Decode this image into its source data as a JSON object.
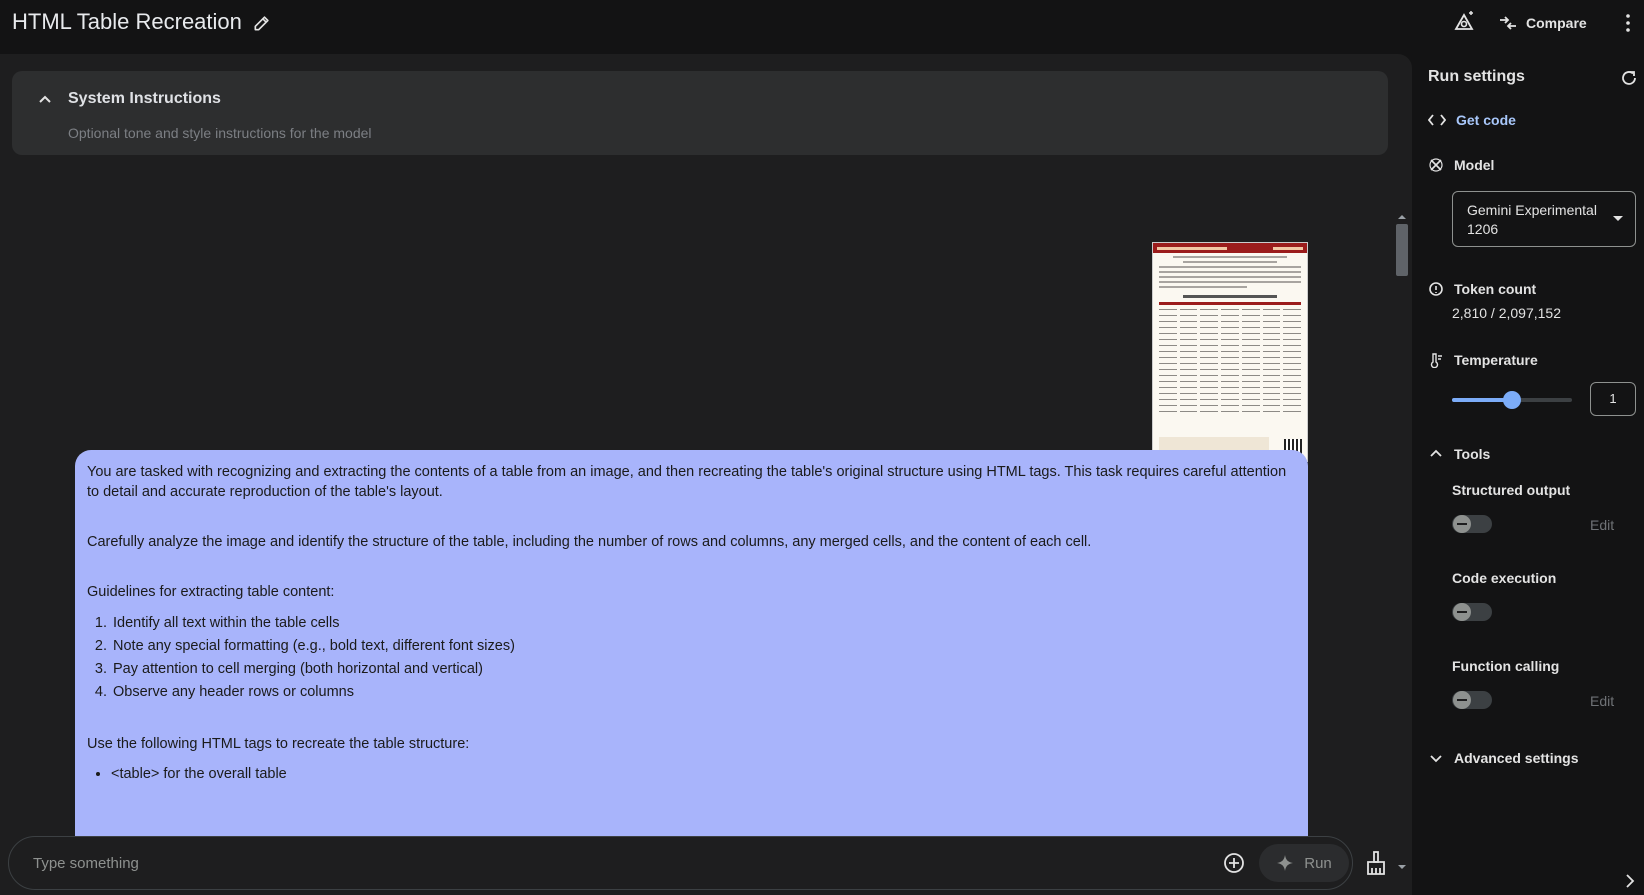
{
  "header": {
    "title": "HTML Table Recreation",
    "compare_label": "Compare"
  },
  "system_instructions": {
    "title": "System Instructions",
    "placeholder": "Optional tone and style instructions for the model"
  },
  "message": {
    "paragraphs": [
      "You are tasked with recognizing and extracting the contents of a table from an image, and then recreating the table's original structure using HTML tags. This task requires careful attention to detail and accurate reproduction of the table's layout.",
      "Carefully analyze the image and identify the structure of the table, including the number of rows and columns, any merged cells, and the content of each cell.",
      "Guidelines for extracting table content:",
      "Use the following HTML tags to recreate the table structure:"
    ],
    "list": [
      "Identify all text within the table cells",
      "Note any special formatting (e.g., bold text, different font sizes)",
      "Pay attention to cell merging (both horizontal and vertical)",
      "Observe any header rows or columns"
    ],
    "bullets": [
      "<table> for the overall table"
    ]
  },
  "input": {
    "placeholder": "Type something",
    "run_label": "Run"
  },
  "settings": {
    "title": "Run settings",
    "get_code": "Get code",
    "model_label": "Model",
    "model_value": "Gemini Experimental 1206",
    "token_label": "Token count",
    "token_value": "2,810 / 2,097,152",
    "temperature_label": "Temperature",
    "temperature_value": "1",
    "tools_label": "Tools",
    "structured_output": "Structured output",
    "code_execution": "Code execution",
    "function_calling": "Function calling",
    "edit": "Edit",
    "advanced_settings": "Advanced settings"
  },
  "colors": {
    "accent": "#7cacf8",
    "bubble": "#a8b4fb",
    "link": "#a8c7fa"
  }
}
